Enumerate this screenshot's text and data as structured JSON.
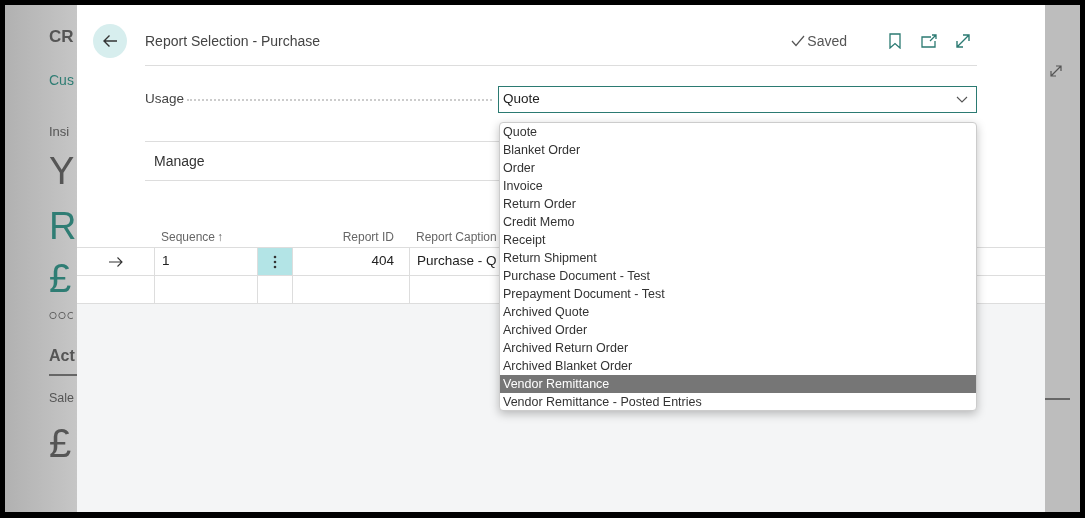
{
  "background_page": {
    "title": "CR",
    "link": "Cus",
    "section": "Insi",
    "headline": "Y",
    "metric": "R",
    "metric_amount": "£",
    "actions_heading": "Act",
    "sales_label": "Sale",
    "sales_amount": "£"
  },
  "dialog": {
    "title": "Report Selection - Purchase",
    "status": "Saved"
  },
  "usage": {
    "label": "Usage",
    "value": "Quote",
    "expanded": true
  },
  "usage_options": [
    {
      "label": "Quote",
      "selected": false
    },
    {
      "label": "Blanket Order",
      "selected": false
    },
    {
      "label": "Order",
      "selected": false
    },
    {
      "label": "Invoice",
      "selected": false
    },
    {
      "label": "Return Order",
      "selected": false
    },
    {
      "label": "Credit Memo",
      "selected": false
    },
    {
      "label": "Receipt",
      "selected": false
    },
    {
      "label": "Return Shipment",
      "selected": false
    },
    {
      "label": "Purchase Document - Test",
      "selected": false
    },
    {
      "label": "Prepayment Document - Test",
      "selected": false
    },
    {
      "label": "Archived Quote",
      "selected": false
    },
    {
      "label": "Archived Order",
      "selected": false
    },
    {
      "label": "Archived Return Order",
      "selected": false
    },
    {
      "label": "Archived Blanket Order",
      "selected": false
    },
    {
      "label": "Vendor Remittance",
      "selected": true
    },
    {
      "label": "Vendor Remittance - Posted Entries",
      "selected": false
    }
  ],
  "action_bar": {
    "label": "Manage"
  },
  "table": {
    "columns": [
      {
        "label": "Sequence",
        "sort_mark": "↑"
      },
      {
        "label": "Report ID"
      },
      {
        "label": "Report Caption"
      }
    ],
    "rows": [
      {
        "current": true,
        "sequence": "1",
        "report_id": "404",
        "report_caption": "Purchase - Q"
      },
      {
        "current": false
      }
    ]
  }
}
